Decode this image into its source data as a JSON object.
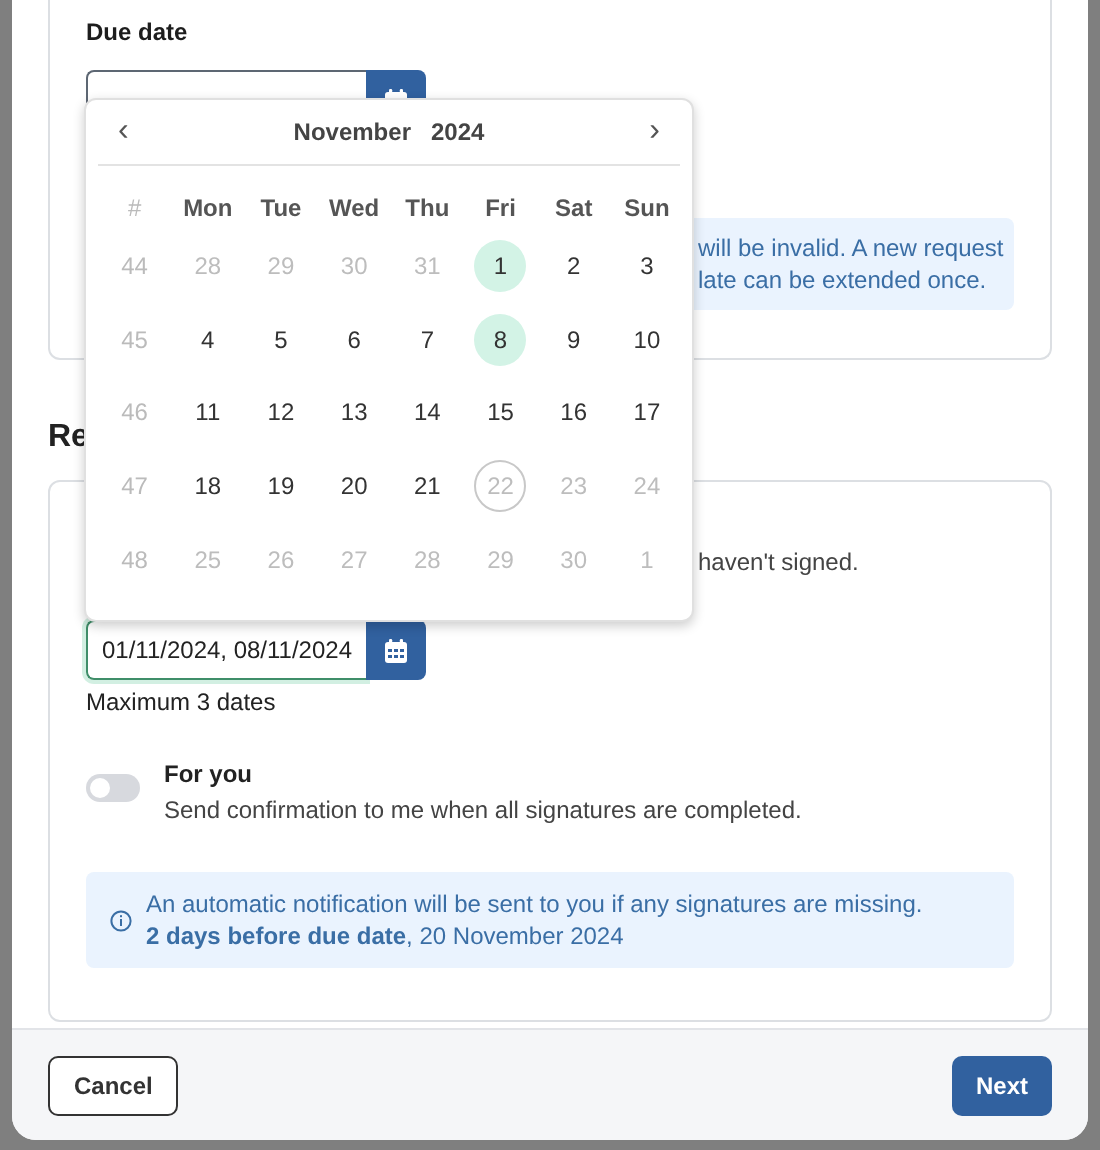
{
  "due_date": {
    "label": "Due date",
    "info_lines": [
      "will be invalid. A new request",
      "late can be extended once."
    ]
  },
  "reminders": {
    "heading": "Re",
    "description_fragment": "haven't signed.",
    "value": "01/11/2024, 08/11/2024",
    "hint": "Maximum 3 dates",
    "toggle": {
      "title": "For you",
      "description": "Send confirmation to me when all signatures are completed.",
      "on": false
    },
    "info": {
      "line1": "An automatic notification will be sent to you if any signatures are missing.",
      "line2": "**2 days before due date**, 20 November 2024"
    }
  },
  "calendar": {
    "prev": "‹",
    "next": "›",
    "month": "November",
    "year": "2024",
    "week_heading": "#",
    "weekdays": [
      "Mon",
      "Tue",
      "Wed",
      "Thu",
      "Fri",
      "Sat",
      "Sun"
    ],
    "weeks": [
      {
        "number": "44",
        "days": [
          {
            "label": "28",
            "kind": "muted",
            "selected": false
          },
          {
            "label": "29",
            "kind": "muted",
            "selected": false
          },
          {
            "label": "30",
            "kind": "muted",
            "selected": false
          },
          {
            "label": "31",
            "kind": "muted",
            "selected": false
          },
          {
            "label": "1",
            "kind": "normal",
            "selected": true
          },
          {
            "label": "2",
            "kind": "normal",
            "selected": false
          },
          {
            "label": "3",
            "kind": "normal",
            "selected": false
          }
        ]
      },
      {
        "number": "45",
        "days": [
          {
            "label": "4",
            "kind": "normal",
            "selected": false
          },
          {
            "label": "5",
            "kind": "normal",
            "selected": false
          },
          {
            "label": "6",
            "kind": "normal",
            "selected": false
          },
          {
            "label": "7",
            "kind": "normal",
            "selected": false
          },
          {
            "label": "8",
            "kind": "normal",
            "selected": true
          },
          {
            "label": "9",
            "kind": "normal",
            "selected": false
          },
          {
            "label": "10",
            "kind": "normal",
            "selected": false
          }
        ]
      },
      {
        "number": "46",
        "days": [
          {
            "label": "11",
            "kind": "normal",
            "selected": false
          },
          {
            "label": "12",
            "kind": "normal",
            "selected": false
          },
          {
            "label": "13",
            "kind": "normal",
            "selected": false
          },
          {
            "label": "14",
            "kind": "normal",
            "selected": false
          },
          {
            "label": "15",
            "kind": "normal",
            "selected": false
          },
          {
            "label": "16",
            "kind": "normal",
            "selected": false
          },
          {
            "label": "17",
            "kind": "normal",
            "selected": false
          }
        ]
      },
      {
        "number": "47",
        "days": [
          {
            "label": "18",
            "kind": "normal",
            "selected": false
          },
          {
            "label": "19",
            "kind": "normal",
            "selected": false
          },
          {
            "label": "20",
            "kind": "normal",
            "selected": false
          },
          {
            "label": "21",
            "kind": "normal",
            "selected": false
          },
          {
            "label": "22",
            "kind": "today",
            "selected": false
          },
          {
            "label": "23",
            "kind": "muted",
            "selected": false
          },
          {
            "label": "24",
            "kind": "muted",
            "selected": false
          }
        ]
      },
      {
        "number": "48",
        "days": [
          {
            "label": "25",
            "kind": "muted",
            "selected": false
          },
          {
            "label": "26",
            "kind": "muted",
            "selected": false
          },
          {
            "label": "27",
            "kind": "muted",
            "selected": false
          },
          {
            "label": "28",
            "kind": "muted",
            "selected": false
          },
          {
            "label": "29",
            "kind": "muted",
            "selected": false
          },
          {
            "label": "30",
            "kind": "muted",
            "selected": false
          },
          {
            "label": "1",
            "kind": "muted",
            "selected": false
          }
        ]
      }
    ]
  },
  "buttons": {
    "cancel": "Cancel",
    "next": "Next"
  }
}
